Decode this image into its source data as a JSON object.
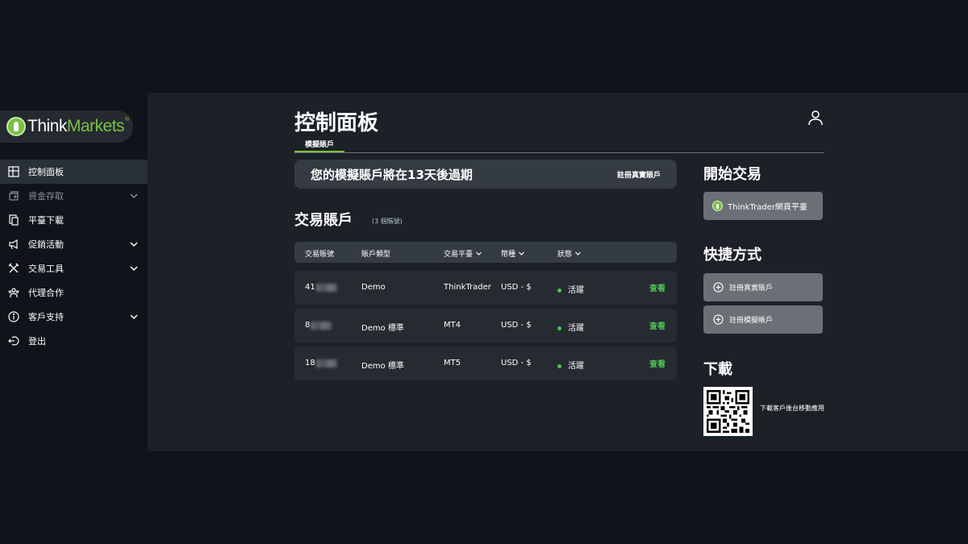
{
  "brand": {
    "name_part1": "Think",
    "name_part2": "Markets",
    "reg": "®",
    "accent": "#7ac143"
  },
  "sidebar": {
    "items": [
      {
        "label": "控制面板",
        "icon": "dashboard-icon",
        "active": true,
        "expandable": false
      },
      {
        "label": "資金存取",
        "icon": "wallet-icon",
        "active": false,
        "expandable": true,
        "muted": true
      },
      {
        "label": "平臺下載",
        "icon": "copy-icon",
        "active": false,
        "expandable": false
      },
      {
        "label": "促銷活動",
        "icon": "megaphone-icon",
        "active": false,
        "expandable": true
      },
      {
        "label": "交易工具",
        "icon": "tools-icon",
        "active": false,
        "expandable": true
      },
      {
        "label": "代理合作",
        "icon": "people-icon",
        "active": false,
        "expandable": false
      },
      {
        "label": "客戶支持",
        "icon": "info-icon",
        "active": false,
        "expandable": true
      },
      {
        "label": "登出",
        "icon": "logout-icon",
        "active": false,
        "expandable": false
      }
    ]
  },
  "header": {
    "title": "控制面板",
    "tab": "模擬賬戶"
  },
  "banner": {
    "text": "您的模擬賬戶將在13天後過期",
    "link": "註冊真實賬戶"
  },
  "accounts": {
    "title": "交易賬戶",
    "count": "(3 個賬號)",
    "columns": [
      "交易賬號",
      "賬戶類型",
      "交易平臺",
      "幣種",
      "狀態"
    ],
    "rows": [
      {
        "no": "41",
        "type": "Demo",
        "platform": "ThinkTrader",
        "currency": "USD - $",
        "status": "活躍",
        "action": "查看"
      },
      {
        "no": "8",
        "type": "Demo 標準",
        "platform": "MT4",
        "currency": "USD - $",
        "status": "活躍",
        "action": "查看"
      },
      {
        "no": "18",
        "type": "Demo 標準",
        "platform": "MT5",
        "currency": "USD - $",
        "status": "活躍",
        "action": "查看"
      }
    ]
  },
  "right": {
    "start_title": "開始交易",
    "tt_button": "ThinkTrader網頁平臺",
    "shortcuts_title": "快捷方式",
    "shortcut_real": "註冊真實賬戶",
    "shortcut_demo": "註冊模擬帳戶",
    "download_title": "下載",
    "download_text": "下載客戶後台移動應用"
  }
}
